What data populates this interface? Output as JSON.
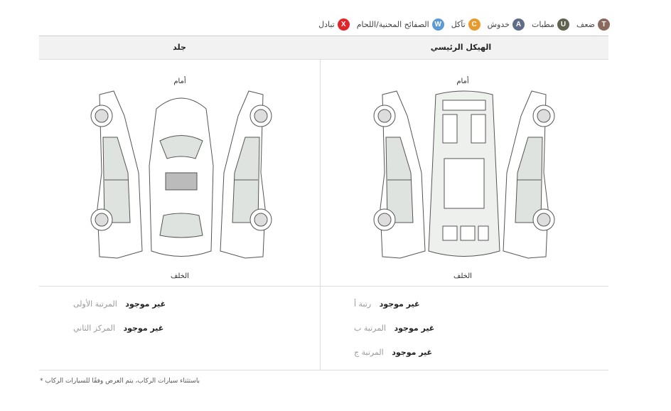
{
  "legend": [
    {
      "letter": "T",
      "label": "ضعف",
      "color": "#8a6a5c"
    },
    {
      "letter": "U",
      "label": "مطبات",
      "color": "#5f6350"
    },
    {
      "letter": "A",
      "label": "خدوش",
      "color": "#5f6d8a"
    },
    {
      "letter": "C",
      "label": "تآكل",
      "color": "#e89a2c"
    },
    {
      "letter": "W",
      "label": "الصفائح المحنية/اللحام",
      "color": "#5b9bd5"
    },
    {
      "letter": "X",
      "label": "تبادل",
      "color": "#e0262b"
    }
  ],
  "sections": {
    "frame": {
      "title": "الهيكل الرئيسي",
      "front": "أمام",
      "rear": "الخلف",
      "conditions": [
        {
          "label": "رتبة أ",
          "value": "غير موجود"
        },
        {
          "label": "المرتبة ب",
          "value": "غير موجود"
        },
        {
          "label": "المرتبة ج",
          "value": "غير موجود"
        }
      ]
    },
    "skin": {
      "title": "جلد",
      "front": "أمام",
      "rear": "الخلف",
      "conditions": [
        {
          "label": "المرتبة الأولى",
          "value": "غير موجود"
        },
        {
          "label": "المركز الثاني",
          "value": "غير موجود"
        }
      ]
    }
  },
  "footnote": "باستثناء سيارات الركاب، يتم العرض وفقًا للسيارات الركاب"
}
